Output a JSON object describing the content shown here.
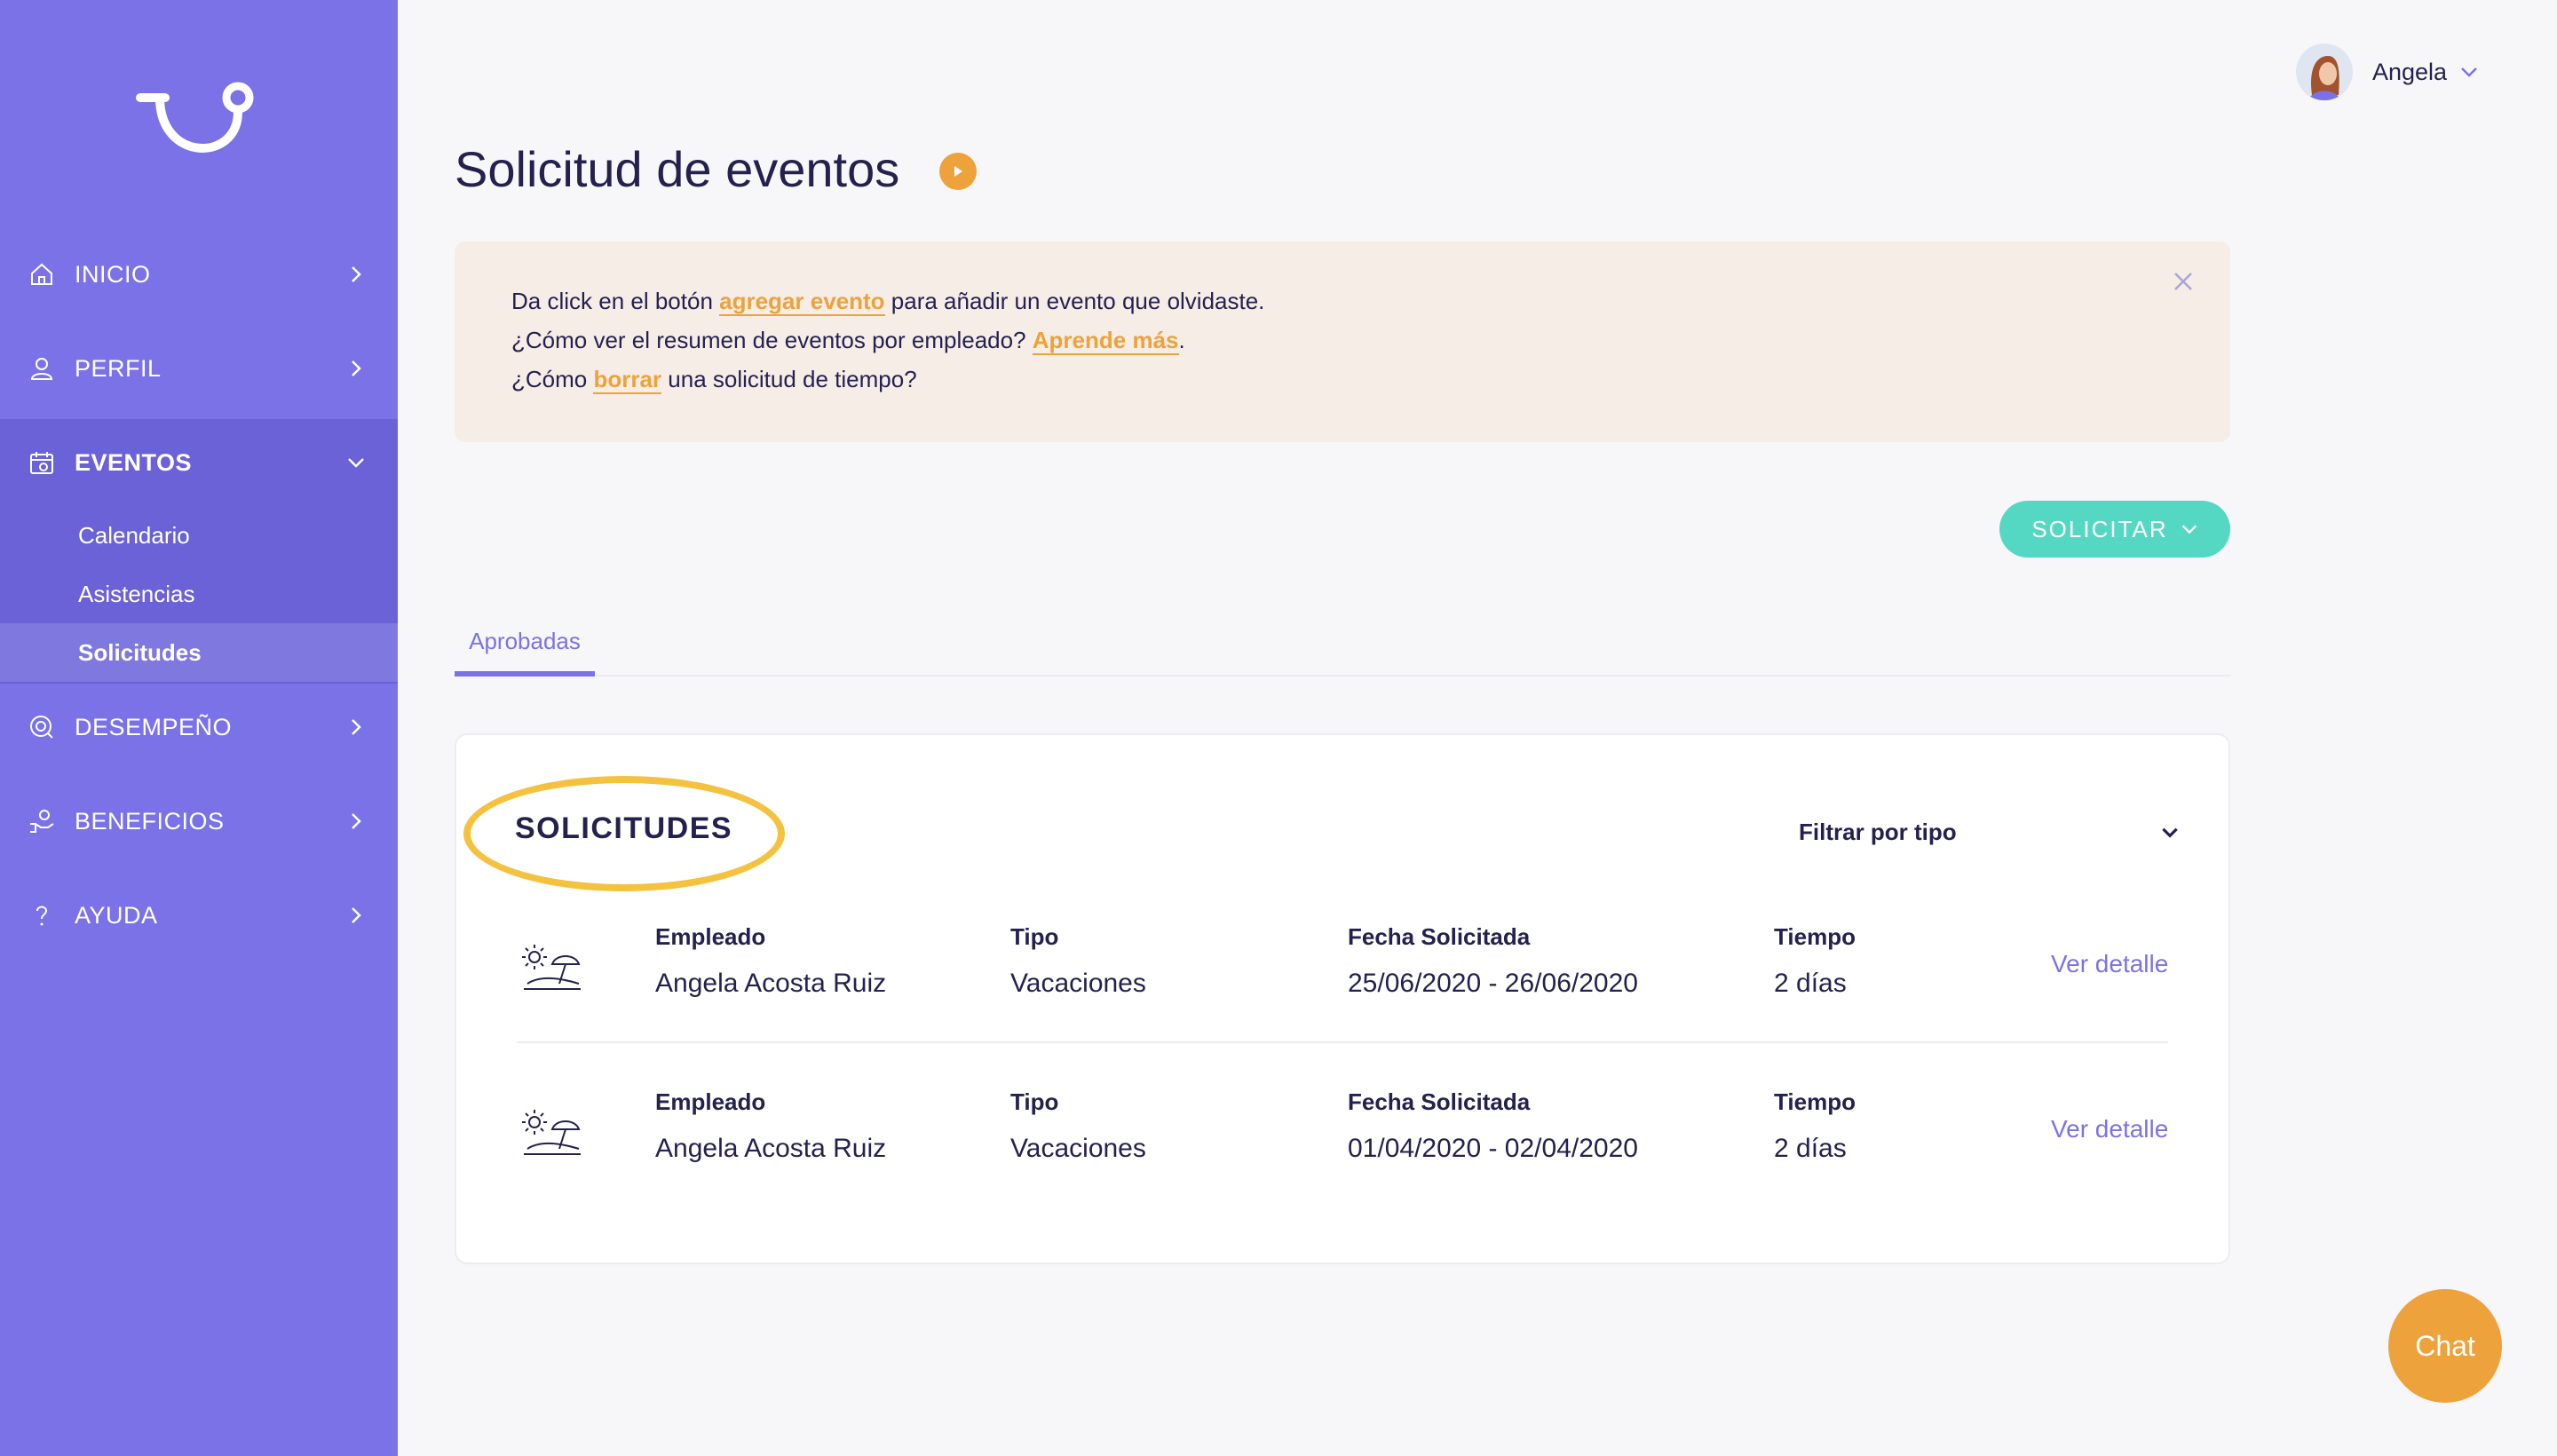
{
  "sidebar": {
    "items": [
      {
        "label": "INICIO"
      },
      {
        "label": "PERFIL"
      },
      {
        "label": "EVENTOS"
      },
      {
        "label": "DESEMPEÑO"
      },
      {
        "label": "BENEFICIOS"
      },
      {
        "label": "AYUDA"
      }
    ],
    "subitems": [
      {
        "label": "Calendario"
      },
      {
        "label": "Asistencias"
      },
      {
        "label": "Solicitudes"
      }
    ]
  },
  "header": {
    "user_name": "Angela"
  },
  "page": {
    "title": "Solicitud de eventos"
  },
  "banner": {
    "line1_pre": "Da click en el botón ",
    "line1_link": "agregar evento",
    "line1_post": " para añadir un evento que olvidaste.",
    "line2_pre": "¿Cómo ver el resumen de eventos por empleado? ",
    "line2_link": "Aprende más",
    "line2_post": ".",
    "line3_pre": "¿Cómo ",
    "line3_link": "borrar",
    "line3_post": " una solicitud de tiempo?"
  },
  "actions": {
    "solicitar_label": "SOLICITAR"
  },
  "tabs": [
    {
      "label": "Aprobadas"
    }
  ],
  "card": {
    "title": "SOLICITUDES",
    "filter_label": "Filtrar por tipo",
    "columns": {
      "empleado": "Empleado",
      "tipo": "Tipo",
      "fecha": "Fecha Solicitada",
      "tiempo": "Tiempo"
    },
    "detail_label": "Ver detalle",
    "rows": [
      {
        "empleado": "Angela Acosta Ruiz",
        "tipo": "Vacaciones",
        "fecha": "25/06/2020 - 26/06/2020",
        "tiempo": "2 días"
      },
      {
        "empleado": "Angela Acosta Ruiz",
        "tipo": "Vacaciones",
        "fecha": "01/04/2020 - 02/04/2020",
        "tiempo": "2 días"
      }
    ]
  },
  "chat": {
    "label": "Chat"
  },
  "colors": {
    "sidebar": "#7b72e8",
    "accent_orange": "#eea23b",
    "accent_teal": "#55d8c3",
    "highlight_yellow": "#f4c23e",
    "text_dark": "#25214f"
  }
}
